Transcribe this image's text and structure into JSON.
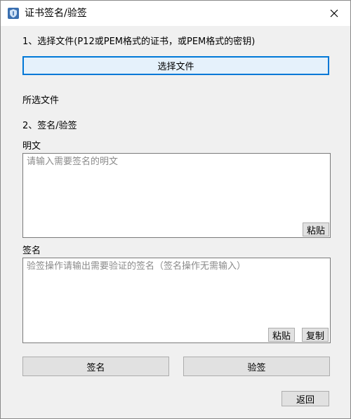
{
  "window": {
    "title": "证书签名/验签"
  },
  "step1": {
    "label": "1、选择文件(P12或PEM格式的证书，或PEM格式的密钥)",
    "choose_button": "选择文件"
  },
  "selected_file_label": "所选文件",
  "step2": {
    "label": "2、签名/验签"
  },
  "plaintext": {
    "label": "明文",
    "placeholder": "请输入需要签名的明文",
    "paste_button": "粘贴"
  },
  "signature": {
    "label": "签名",
    "placeholder": "验签操作请输出需要验证的签名（签名操作无需输入）",
    "paste_button": "粘贴",
    "copy_button": "复制"
  },
  "actions": {
    "sign_button": "签名",
    "verify_button": "验签",
    "back_button": "返回"
  },
  "icons": {
    "app": "shield-icon",
    "close": "close-icon"
  }
}
